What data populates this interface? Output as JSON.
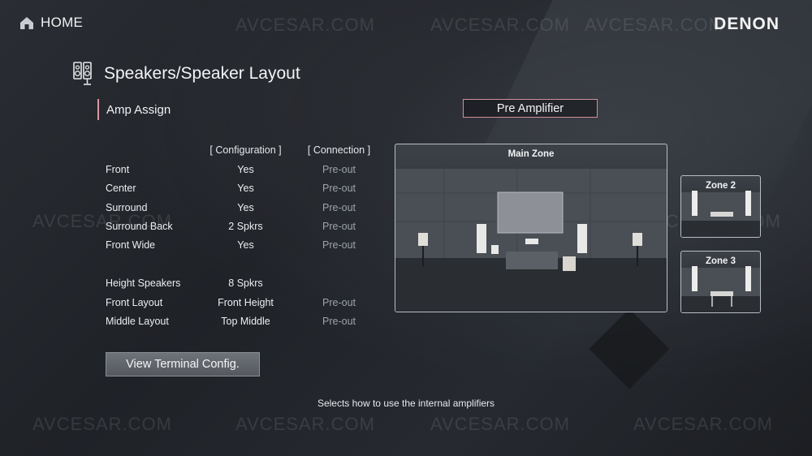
{
  "header": {
    "home_label": "HOME",
    "brand": "DENON"
  },
  "page": {
    "title": "Speakers/Speaker Layout"
  },
  "amp_assign": {
    "label": "Amp Assign",
    "value": "Pre Amplifier"
  },
  "table": {
    "col_config": "[ Configuration ]",
    "col_connection": "[ Connection ]",
    "rows": [
      {
        "name": "Front",
        "config": "Yes",
        "connection": "Pre-out"
      },
      {
        "name": "Center",
        "config": "Yes",
        "connection": "Pre-out"
      },
      {
        "name": "Surround",
        "config": "Yes",
        "connection": "Pre-out"
      },
      {
        "name": "Surround Back",
        "config": "2 Spkrs",
        "connection": "Pre-out"
      },
      {
        "name": "Front Wide",
        "config": "Yes",
        "connection": "Pre-out"
      },
      {
        "name": "Height Speakers",
        "config": "8 Spkrs",
        "connection": ""
      },
      {
        "name": "Front Layout",
        "config": "Front Height",
        "connection": "Pre-out"
      },
      {
        "name": "Middle Layout",
        "config": "Top Middle",
        "connection": "Pre-out"
      }
    ]
  },
  "view_terminal_button": "View Terminal Config.",
  "status_text": "Selects how to use the internal amplifiers",
  "zones": {
    "main": "Main Zone",
    "zone2": "Zone 2",
    "zone3": "Zone 3"
  },
  "watermark": "AVCESAR.COM",
  "icons": {
    "home": "home-icon",
    "speaker": "speaker-icon"
  },
  "colors": {
    "accent": "#d99aa2",
    "background": "#24272c"
  }
}
